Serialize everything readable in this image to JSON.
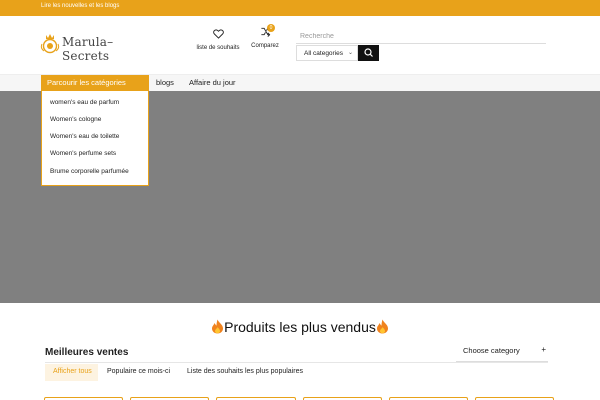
{
  "topbar": {
    "link": "Lire les nouvelles et les blogs"
  },
  "header": {
    "logo_text": "Marula–Secrets",
    "wishlist_label": "liste de souhaits",
    "compare_label": "Comparez",
    "compare_count": "0",
    "search_placeholder": "Recherche",
    "category_select": "All categories"
  },
  "nav": {
    "browse": "Parcourir les catégories",
    "items": [
      "blogs",
      "Affaire du jour"
    ]
  },
  "dropdown": {
    "items": [
      "women's eau de parfum",
      "Women's cologne",
      "Women's eau de toilette",
      "Women's perfume sets",
      "Brume corporelle parfumée"
    ]
  },
  "section": {
    "title": "Produits les plus vendus"
  },
  "best_sellers": {
    "title": "Meilleures ventes",
    "choose_category": "Choose category",
    "tabs": [
      "Afficher tous",
      "Populaire ce mois-ci",
      "Liste des souhaits les plus populaires"
    ]
  },
  "colors": {
    "accent": "#e8a21a",
    "hero": "#808080",
    "dark": "#111111"
  },
  "icons": [
    "logo-icon",
    "heart-icon",
    "shuffle-icon",
    "search-icon",
    "chevron-down-icon",
    "plus-icon",
    "flame-icon"
  ]
}
